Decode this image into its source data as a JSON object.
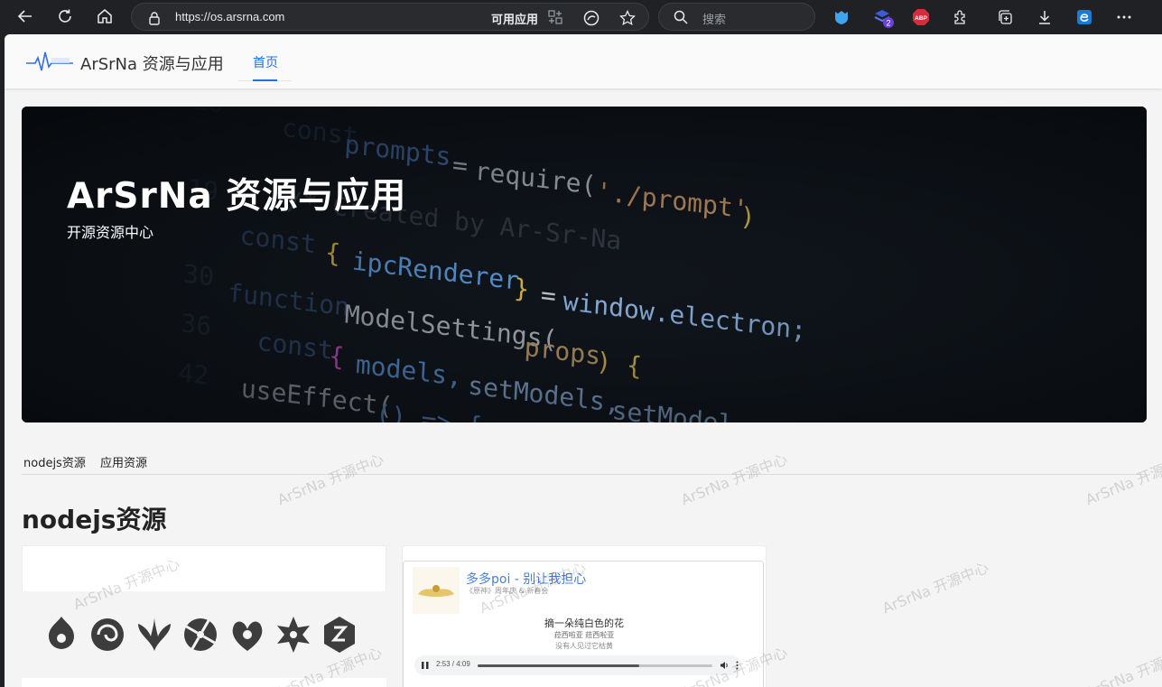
{
  "browser": {
    "url": "https://os.arsrna.com",
    "apps_label": "可用应用",
    "search_placeholder": "搜索",
    "extension_badge": "2",
    "abp_label": "ABP",
    "colors": {
      "chrome_bg": "#202124",
      "accent": "#1a73e8"
    }
  },
  "site": {
    "name": "ArSrNa 资源与应用",
    "nav": {
      "home": "首页"
    }
  },
  "hero": {
    "title": "ArSrNa 资源与应用",
    "subtitle": "开源资源中心",
    "code_lines": [
      "const prompts = require('./prompt')",
      "/* Created by Ar-Sr-Na",
      "const { ipcRenderer } = window.electron;",
      "function ModelSettings(props) {",
      "  const { models, setModels, setModel",
      "  useEffect(() => {"
    ]
  },
  "tabs": [
    "nodejs资源",
    "应用资源"
  ],
  "section": {
    "title": "nodejs资源"
  },
  "player": {
    "song_title": "多多poi - 别让我担心",
    "artist": "《原神》周年庆 & 新春会",
    "lyric_main": "摘一朵纯白色的花",
    "lyric_sub": "菈西啦亚 菈西啦亚",
    "lyric_trans": "没有人见过它枯黄",
    "time": "2:53 / 4:09",
    "progress": 0.69
  },
  "watermark": "ArSrNa 开源中心"
}
